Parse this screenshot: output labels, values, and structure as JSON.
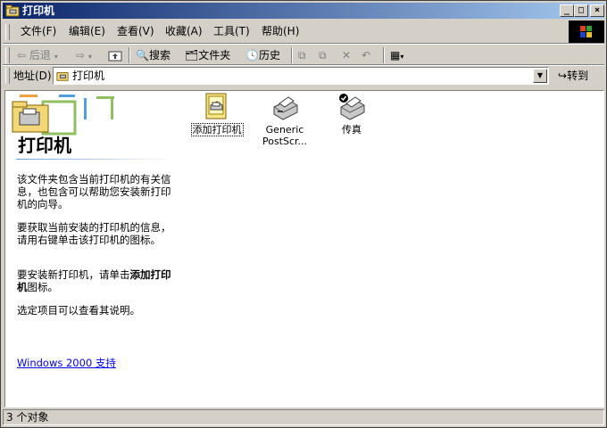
{
  "window": {
    "title": "打印机"
  },
  "title_buttons": {
    "minimize": "_",
    "maximize": "□",
    "close": "×"
  },
  "menu": [
    {
      "label": "文件(F)"
    },
    {
      "label": "编辑(E)"
    },
    {
      "label": "查看(V)"
    },
    {
      "label": "收藏(A)"
    },
    {
      "label": "工具(T)"
    },
    {
      "label": "帮助(H)"
    }
  ],
  "toolbar": {
    "back": "后退",
    "search": "搜索",
    "folders": "文件夹",
    "history": "历史"
  },
  "address": {
    "label": "地址(D)",
    "value": "打印机",
    "go": "转到"
  },
  "panel": {
    "title": "打印机",
    "para1": "该文件夹包含当前打印机的有关信息，也包含可以帮助您安装新打印机的向导。",
    "para2": "要获取当前安装的打印机的信息，请用右键单击该打印机的图标。",
    "para3_prefix": "要安装新打印机，请单击",
    "para3_bold": "添加打印机",
    "para3_suffix": "图标。",
    "para4": "选定项目可以查看其说明。",
    "support_link": "Windows 2000 支持"
  },
  "items": [
    {
      "label": "添加打印机",
      "icon": "add-printer-icon"
    },
    {
      "label": "Generic PostScr...",
      "icon": "printer-icon"
    },
    {
      "label": "传真",
      "icon": "fax-printer-icon"
    }
  ],
  "status": {
    "text": "3 个对象"
  },
  "colors": {
    "titlebar_start": "#0a246a",
    "titlebar_end": "#a6caf0",
    "face": "#d4d0c8",
    "link": "#0000ee"
  }
}
